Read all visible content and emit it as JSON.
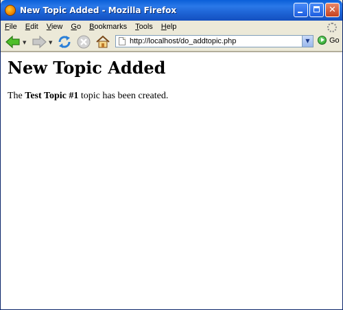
{
  "window": {
    "title": "New Topic Added - Mozilla Firefox",
    "controls": {
      "minimize": "minimize",
      "maximize": "maximize",
      "close": "✕"
    }
  },
  "menu": {
    "items": [
      {
        "accel": "F",
        "rest": "ile"
      },
      {
        "accel": "E",
        "rest": "dit"
      },
      {
        "accel": "V",
        "rest": "iew"
      },
      {
        "accel": "G",
        "rest": "o"
      },
      {
        "accel": "B",
        "rest": "ookmarks"
      },
      {
        "accel": "T",
        "rest": "ools"
      },
      {
        "accel": "H",
        "rest": "elp"
      }
    ]
  },
  "toolbar": {
    "icons": [
      "back-arrow-icon",
      "forward-arrow-icon",
      "reload-icon",
      "stop-icon",
      "home-icon"
    ],
    "url": "http://localhost/do_addtopic.php",
    "go_label": "Go"
  },
  "page": {
    "heading": "New Topic Added",
    "message_prefix": "The ",
    "topic_name": "Test Topic #1",
    "message_suffix": " topic has been created."
  },
  "colors": {
    "titlebar": "#1b5fd0",
    "chrome": "#ece9d8",
    "content_bg": "#ffffff"
  }
}
